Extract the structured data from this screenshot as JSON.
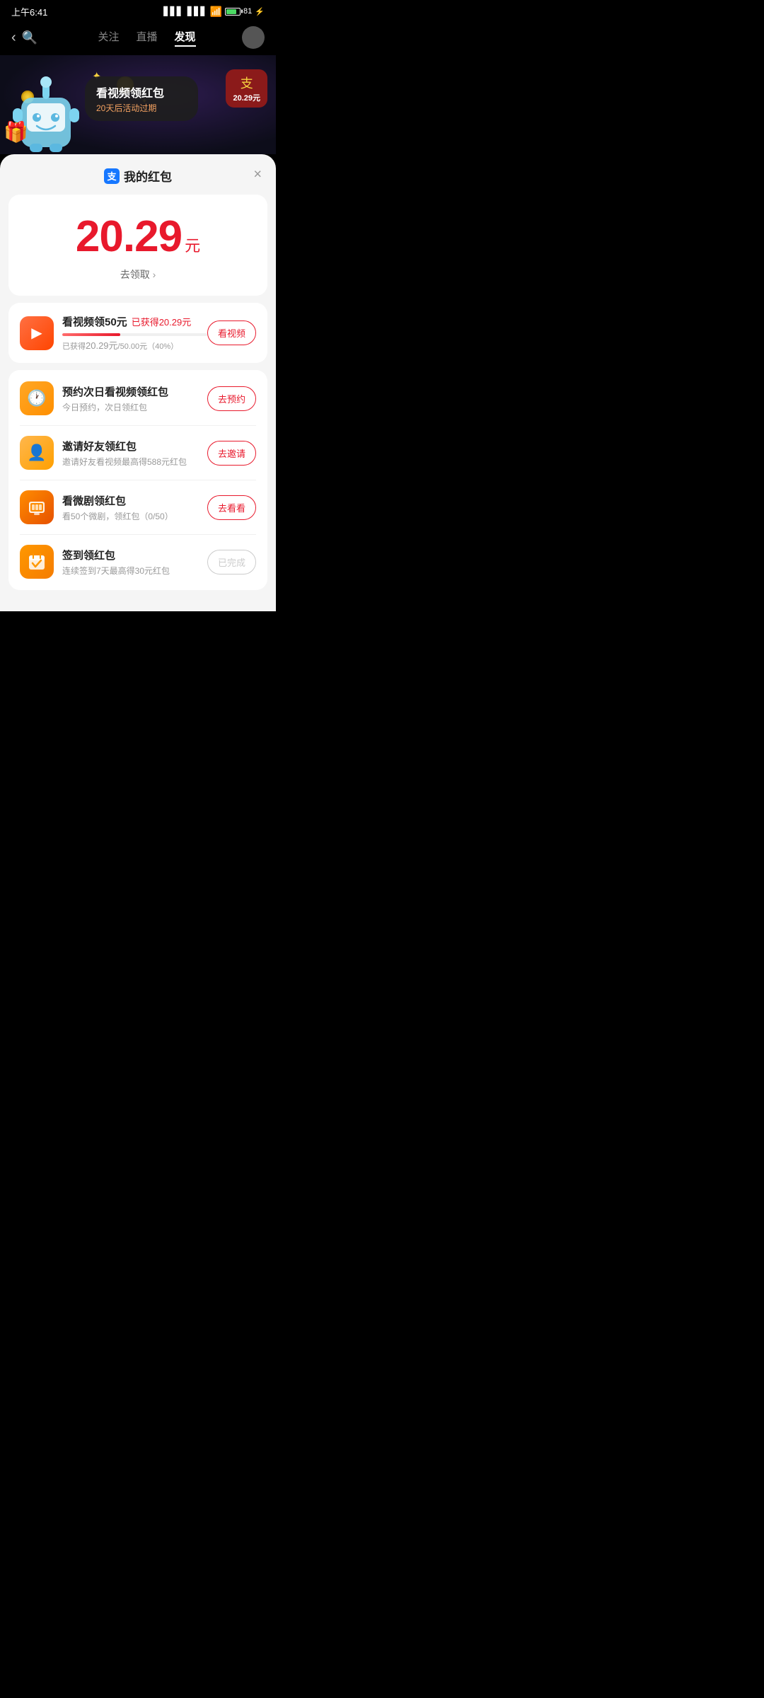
{
  "statusBar": {
    "time": "上午6:41",
    "battery": "81"
  },
  "navBar": {
    "tabs": [
      {
        "id": "follow",
        "label": "关注",
        "active": false
      },
      {
        "id": "live",
        "label": "直播",
        "active": false
      },
      {
        "id": "discover",
        "label": "发现",
        "active": true
      }
    ]
  },
  "banner": {
    "popupTitle": "看视频领红包",
    "popupSub": "20天后活动过期",
    "badgeAmount": "20.29元"
  },
  "modal": {
    "titleIcon": "支",
    "title": "我的红包",
    "amount": "20.29",
    "unit": "元",
    "claimLink": "去领取",
    "closeLabel": "×"
  },
  "tasks": [
    {
      "id": "watch-video",
      "iconType": "video",
      "iconEmoji": "▶",
      "title": "看视频领50元",
      "earned": "已获得20.29元",
      "progressText": "已获得",
      "earnedAmount": "20.29元",
      "slash": "/50.00元（40%）",
      "progressPercent": 40,
      "btnLabel": "看视频",
      "btnDone": false
    },
    {
      "id": "reserve",
      "iconType": "clock",
      "iconEmoji": "🕐",
      "title": "预约次日看视频领红包",
      "subtitle": "今日预约，次日领红包",
      "btnLabel": "去预约",
      "btnDone": false
    },
    {
      "id": "invite",
      "iconType": "friend",
      "iconEmoji": "👤",
      "title": "邀请好友领红包",
      "subtitle": "邀请好友看视频最高得588元红包",
      "btnLabel": "去邀请",
      "btnDone": false
    },
    {
      "id": "drama",
      "iconType": "drama",
      "iconEmoji": "📺",
      "title": "看微剧领红包",
      "subtitle": "看50个微剧，领红包（0/50）",
      "btnLabel": "去看看",
      "btnDone": false
    },
    {
      "id": "checkin",
      "iconType": "checkin",
      "iconEmoji": "✓",
      "title": "签到领红包",
      "subtitle": "连续签到7天最高得30元红包",
      "btnLabel": "已完成",
      "btnDone": true
    }
  ]
}
